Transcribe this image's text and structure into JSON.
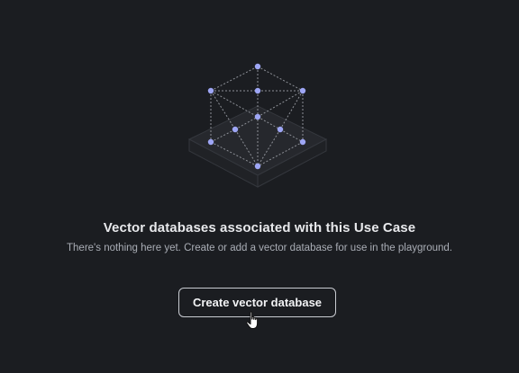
{
  "empty_state": {
    "title": "Vector databases associated with this Use Case",
    "subtitle": "There's nothing here yet. Create or add a vector database for use in the playground.",
    "illustration_icon": "vector-database-cube-icon",
    "cursor_icon": "hand-pointer-icon"
  },
  "actions": {
    "create_label": "Create vector database"
  },
  "colors": {
    "background": "#1b1d21",
    "node": "#9ea6f5",
    "edge": "#8d9097",
    "title": "#e8e9ec",
    "subtitle": "#a9adb5",
    "button_border": "#c9ccd2"
  }
}
